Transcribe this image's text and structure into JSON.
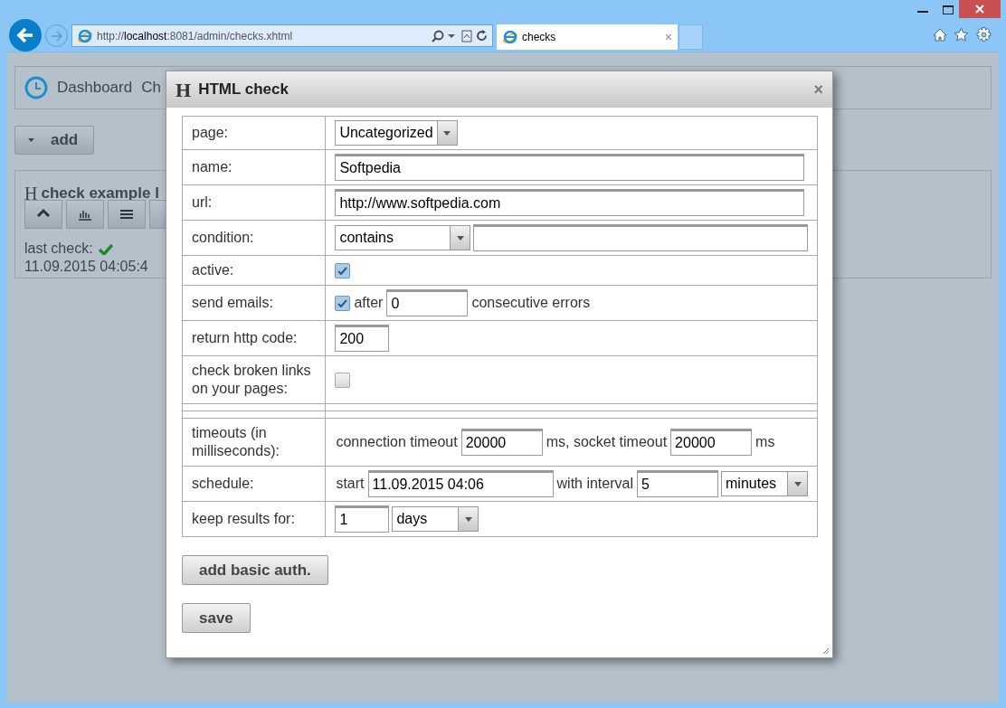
{
  "browser": {
    "address": "http://**localhost**:8081/admin/checks.xhtml",
    "tab": {
      "title": "checks",
      "close": "×",
      "selected": true
    }
  },
  "page": {
    "nav": [
      "Dashboard",
      "Ch"
    ],
    "add_button": "add",
    "check_card": {
      "icon": "H",
      "title": "check example l",
      "last_check_label": "last check:",
      "last_check_ok": true,
      "last_check_time": "11.09.2015 04:05:4"
    }
  },
  "dialog": {
    "icon": "H",
    "title": "HTML check",
    "close": "×",
    "rows": [
      {
        "label": "page:",
        "controls": [
          {
            "kind": "select",
            "value": "Uncategorized"
          }
        ]
      },
      {
        "label": "name:",
        "controls": [
          {
            "kind": "field",
            "value": "Softpedia"
          }
        ]
      },
      {
        "label": "url:",
        "controls": [
          {
            "kind": "field",
            "value": "http://www.softpedia.com"
          }
        ]
      },
      {
        "label": "condition:",
        "controls": [
          {
            "kind": "select",
            "value": "contains"
          },
          {
            "kind": "field"
          }
        ]
      },
      {
        "label": "active:",
        "controls": [
          {
            "kind": "checkbox",
            "checked": true
          }
        ]
      },
      {
        "label": "send emails:",
        "controls": [
          {
            "kind": "checkbox",
            "checked": true
          },
          {
            "kind": "text",
            "value": "after"
          },
          {
            "kind": "short-field",
            "value": "0"
          },
          {
            "kind": "text",
            "value": "consecutive errors"
          }
        ]
      },
      {
        "label": "return http code:",
        "controls": [
          {
            "kind": "tiny-field",
            "value": "200"
          }
        ]
      },
      {
        "label": "check broken links on your pages:",
        "controls": [
          {
            "kind": "checkbox",
            "checked": false
          }
        ]
      },
      {
        "kind": "blank"
      },
      {
        "kind": "blank"
      },
      {
        "label": "timeouts (in milliseconds):",
        "controls": [
          {
            "kind": "text",
            "value": "connection timeout"
          },
          {
            "kind": "short-field",
            "value": "20000"
          },
          {
            "kind": "text",
            "value": "ms, socket timeout"
          },
          {
            "kind": "short-field",
            "value": "20000"
          },
          {
            "kind": "text",
            "value": "ms"
          }
        ]
      },
      {
        "label": "schedule:",
        "controls": [
          {
            "kind": "text",
            "value": "start"
          },
          {
            "kind": "date-field",
            "value": "11.09.2015 04:06"
          },
          {
            "kind": "text",
            "value": "with interval"
          },
          {
            "kind": "short-field",
            "value": "5"
          },
          {
            "kind": "select",
            "value": "minutes"
          }
        ]
      },
      {
        "label": "keep results for:",
        "controls": [
          {
            "kind": "tiny-field",
            "value": "1"
          },
          {
            "kind": "select",
            "value": "days"
          }
        ]
      }
    ],
    "buttons": [
      "add basic auth.",
      "save"
    ]
  }
}
